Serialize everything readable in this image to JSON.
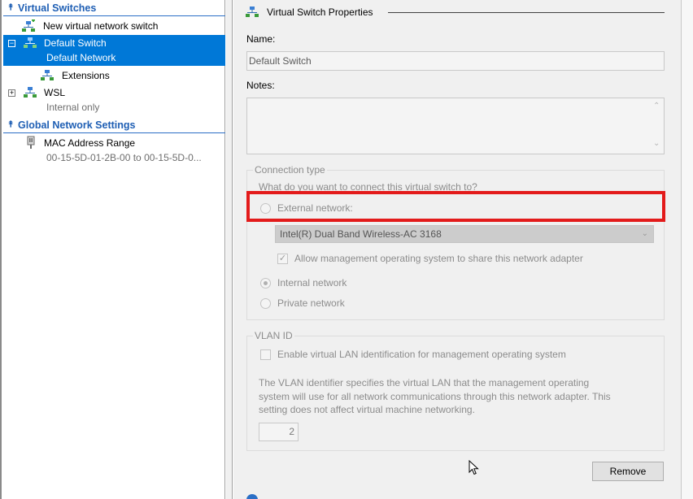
{
  "left_pane": {
    "virtual_switches_header": "Virtual Switches",
    "new_switch_label": "New virtual network switch",
    "default_switch": {
      "name": "Default Switch",
      "subtitle": "Default Network"
    },
    "extensions_label": "Extensions",
    "wsl": {
      "name": "WSL",
      "subtitle": "Internal only"
    },
    "global_settings_header": "Global Network Settings",
    "mac_range": {
      "name": "MAC Address Range",
      "value": "00-15-5D-01-2B-00 to 00-15-5D-0..."
    }
  },
  "properties": {
    "section_title": "Virtual Switch Properties",
    "name_label": "Name:",
    "name_value": "Default Switch",
    "notes_label": "Notes:",
    "connection_type": {
      "group_label": "Connection type",
      "question": "What do you want to connect this virtual switch to?",
      "external_label": "External network:",
      "adapter_selected": "Intel(R) Dual Band Wireless-AC 3168",
      "allow_management_label": "Allow management operating system to share this network adapter",
      "allow_management_checked": true,
      "internal_label": "Internal network",
      "private_label": "Private network",
      "selected": "Internal network"
    },
    "vlan": {
      "group_label": "VLAN ID",
      "enable_label": "Enable virtual LAN identification for management operating system",
      "enable_checked": false,
      "description_line1": "The VLAN identifier specifies the virtual LAN that the management operating",
      "description_line2": "system will use for all network communications through this network adapter. This",
      "description_line3": "setting does not affect virtual machine networking.",
      "vlan_value": "2"
    },
    "remove_button": "Remove"
  },
  "colors": {
    "selection": "#0078d7",
    "header_blue": "#1f5fb4",
    "highlight": "#e31b1b"
  }
}
